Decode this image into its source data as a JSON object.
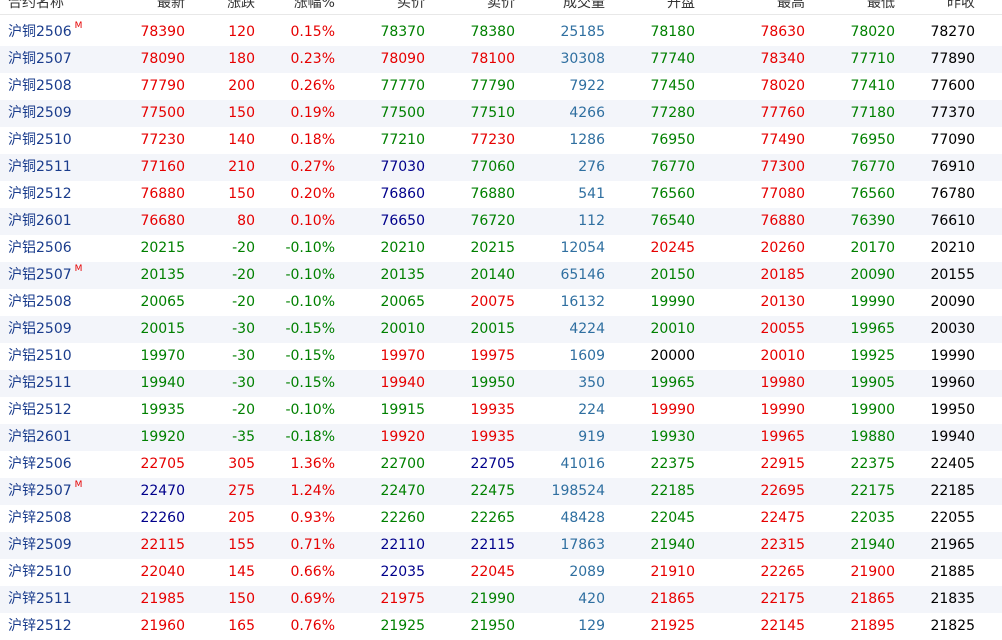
{
  "headers": [
    "合约名称",
    "最新",
    "涨跌",
    "涨幅%",
    "买价",
    "卖价",
    "成交量",
    "开盘",
    "最高",
    "最低",
    "昨收"
  ],
  "colors": {
    "up": "#e60000",
    "down": "#008000",
    "flat": "#000000",
    "navy": "#00008b",
    "volume": "#2f6fa0",
    "name": "#1a3c8c"
  },
  "rows": [
    {
      "name": "沪铜2506",
      "mark": "M",
      "cells": [
        {
          "v": "78390",
          "c": "up"
        },
        {
          "v": "120",
          "c": "up"
        },
        {
          "v": "0.15%",
          "c": "up"
        },
        {
          "v": "78370",
          "c": "dn"
        },
        {
          "v": "78380",
          "c": "dn"
        },
        {
          "v": "25185",
          "c": "vol"
        },
        {
          "v": "78180",
          "c": "dn"
        },
        {
          "v": "78630",
          "c": "up"
        },
        {
          "v": "78020",
          "c": "dn"
        },
        {
          "v": "78270",
          "c": "fl"
        }
      ]
    },
    {
      "name": "沪铜2507",
      "mark": "",
      "cells": [
        {
          "v": "78090",
          "c": "up"
        },
        {
          "v": "180",
          "c": "up"
        },
        {
          "v": "0.23%",
          "c": "up"
        },
        {
          "v": "78090",
          "c": "up"
        },
        {
          "v": "78100",
          "c": "up"
        },
        {
          "v": "30308",
          "c": "vol"
        },
        {
          "v": "77740",
          "c": "dn"
        },
        {
          "v": "78340",
          "c": "up"
        },
        {
          "v": "77710",
          "c": "dn"
        },
        {
          "v": "77890",
          "c": "fl"
        }
      ]
    },
    {
      "name": "沪铜2508",
      "mark": "",
      "cells": [
        {
          "v": "77790",
          "c": "up"
        },
        {
          "v": "200",
          "c": "up"
        },
        {
          "v": "0.26%",
          "c": "up"
        },
        {
          "v": "77770",
          "c": "dn"
        },
        {
          "v": "77790",
          "c": "dn"
        },
        {
          "v": "7922",
          "c": "vol"
        },
        {
          "v": "77450",
          "c": "dn"
        },
        {
          "v": "78020",
          "c": "up"
        },
        {
          "v": "77410",
          "c": "dn"
        },
        {
          "v": "77600",
          "c": "fl"
        }
      ]
    },
    {
      "name": "沪铜2509",
      "mark": "",
      "cells": [
        {
          "v": "77500",
          "c": "up"
        },
        {
          "v": "150",
          "c": "up"
        },
        {
          "v": "0.19%",
          "c": "up"
        },
        {
          "v": "77500",
          "c": "dn"
        },
        {
          "v": "77510",
          "c": "dn"
        },
        {
          "v": "4266",
          "c": "vol"
        },
        {
          "v": "77280",
          "c": "dn"
        },
        {
          "v": "77760",
          "c": "up"
        },
        {
          "v": "77180",
          "c": "dn"
        },
        {
          "v": "77370",
          "c": "fl"
        }
      ]
    },
    {
      "name": "沪铜2510",
      "mark": "",
      "cells": [
        {
          "v": "77230",
          "c": "up"
        },
        {
          "v": "140",
          "c": "up"
        },
        {
          "v": "0.18%",
          "c": "up"
        },
        {
          "v": "77210",
          "c": "dn"
        },
        {
          "v": "77230",
          "c": "up"
        },
        {
          "v": "1286",
          "c": "vol"
        },
        {
          "v": "76950",
          "c": "dn"
        },
        {
          "v": "77490",
          "c": "up"
        },
        {
          "v": "76950",
          "c": "dn"
        },
        {
          "v": "77090",
          "c": "fl"
        }
      ]
    },
    {
      "name": "沪铜2511",
      "mark": "",
      "cells": [
        {
          "v": "77160",
          "c": "up"
        },
        {
          "v": "210",
          "c": "up"
        },
        {
          "v": "0.27%",
          "c": "up"
        },
        {
          "v": "77030",
          "c": "nb"
        },
        {
          "v": "77060",
          "c": "dn"
        },
        {
          "v": "276",
          "c": "vol"
        },
        {
          "v": "76770",
          "c": "dn"
        },
        {
          "v": "77300",
          "c": "up"
        },
        {
          "v": "76770",
          "c": "dn"
        },
        {
          "v": "76910",
          "c": "fl"
        }
      ]
    },
    {
      "name": "沪铜2512",
      "mark": "",
      "cells": [
        {
          "v": "76880",
          "c": "up"
        },
        {
          "v": "150",
          "c": "up"
        },
        {
          "v": "0.20%",
          "c": "up"
        },
        {
          "v": "76860",
          "c": "nb"
        },
        {
          "v": "76880",
          "c": "dn"
        },
        {
          "v": "541",
          "c": "vol"
        },
        {
          "v": "76560",
          "c": "dn"
        },
        {
          "v": "77080",
          "c": "up"
        },
        {
          "v": "76560",
          "c": "dn"
        },
        {
          "v": "76780",
          "c": "fl"
        }
      ]
    },
    {
      "name": "沪铜2601",
      "mark": "",
      "cells": [
        {
          "v": "76680",
          "c": "up"
        },
        {
          "v": "80",
          "c": "up"
        },
        {
          "v": "0.10%",
          "c": "up"
        },
        {
          "v": "76650",
          "c": "nb"
        },
        {
          "v": "76720",
          "c": "dn"
        },
        {
          "v": "112",
          "c": "vol"
        },
        {
          "v": "76540",
          "c": "dn"
        },
        {
          "v": "76880",
          "c": "up"
        },
        {
          "v": "76390",
          "c": "dn"
        },
        {
          "v": "76610",
          "c": "fl"
        }
      ]
    },
    {
      "name": "沪铝2506",
      "mark": "",
      "cells": [
        {
          "v": "20215",
          "c": "dn"
        },
        {
          "v": "-20",
          "c": "dn"
        },
        {
          "v": "-0.10%",
          "c": "dn"
        },
        {
          "v": "20210",
          "c": "dn"
        },
        {
          "v": "20215",
          "c": "dn"
        },
        {
          "v": "12054",
          "c": "vol"
        },
        {
          "v": "20245",
          "c": "up"
        },
        {
          "v": "20260",
          "c": "up"
        },
        {
          "v": "20170",
          "c": "dn"
        },
        {
          "v": "20210",
          "c": "fl"
        }
      ]
    },
    {
      "name": "沪铝2507",
      "mark": "M",
      "cells": [
        {
          "v": "20135",
          "c": "dn"
        },
        {
          "v": "-20",
          "c": "dn"
        },
        {
          "v": "-0.10%",
          "c": "dn"
        },
        {
          "v": "20135",
          "c": "dn"
        },
        {
          "v": "20140",
          "c": "dn"
        },
        {
          "v": "65146",
          "c": "vol"
        },
        {
          "v": "20150",
          "c": "dn"
        },
        {
          "v": "20185",
          "c": "up"
        },
        {
          "v": "20090",
          "c": "dn"
        },
        {
          "v": "20155",
          "c": "fl"
        }
      ]
    },
    {
      "name": "沪铝2508",
      "mark": "",
      "cells": [
        {
          "v": "20065",
          "c": "dn"
        },
        {
          "v": "-20",
          "c": "dn"
        },
        {
          "v": "-0.10%",
          "c": "dn"
        },
        {
          "v": "20065",
          "c": "dn"
        },
        {
          "v": "20075",
          "c": "up"
        },
        {
          "v": "16132",
          "c": "vol"
        },
        {
          "v": "19990",
          "c": "dn"
        },
        {
          "v": "20130",
          "c": "up"
        },
        {
          "v": "19990",
          "c": "dn"
        },
        {
          "v": "20090",
          "c": "fl"
        }
      ]
    },
    {
      "name": "沪铝2509",
      "mark": "",
      "cells": [
        {
          "v": "20015",
          "c": "dn"
        },
        {
          "v": "-30",
          "c": "dn"
        },
        {
          "v": "-0.15%",
          "c": "dn"
        },
        {
          "v": "20010",
          "c": "dn"
        },
        {
          "v": "20015",
          "c": "dn"
        },
        {
          "v": "4224",
          "c": "vol"
        },
        {
          "v": "20010",
          "c": "dn"
        },
        {
          "v": "20055",
          "c": "up"
        },
        {
          "v": "19965",
          "c": "dn"
        },
        {
          "v": "20030",
          "c": "fl"
        }
      ]
    },
    {
      "name": "沪铝2510",
      "mark": "",
      "cells": [
        {
          "v": "19970",
          "c": "dn"
        },
        {
          "v": "-30",
          "c": "dn"
        },
        {
          "v": "-0.15%",
          "c": "dn"
        },
        {
          "v": "19970",
          "c": "up"
        },
        {
          "v": "19975",
          "c": "up"
        },
        {
          "v": "1609",
          "c": "vol"
        },
        {
          "v": "20000",
          "c": "fl"
        },
        {
          "v": "20010",
          "c": "up"
        },
        {
          "v": "19925",
          "c": "dn"
        },
        {
          "v": "19990",
          "c": "fl"
        }
      ]
    },
    {
      "name": "沪铝2511",
      "mark": "",
      "cells": [
        {
          "v": "19940",
          "c": "dn"
        },
        {
          "v": "-30",
          "c": "dn"
        },
        {
          "v": "-0.15%",
          "c": "dn"
        },
        {
          "v": "19940",
          "c": "up"
        },
        {
          "v": "19950",
          "c": "dn"
        },
        {
          "v": "350",
          "c": "vol"
        },
        {
          "v": "19965",
          "c": "dn"
        },
        {
          "v": "19980",
          "c": "up"
        },
        {
          "v": "19905",
          "c": "dn"
        },
        {
          "v": "19960",
          "c": "fl"
        }
      ]
    },
    {
      "name": "沪铝2512",
      "mark": "",
      "cells": [
        {
          "v": "19935",
          "c": "dn"
        },
        {
          "v": "-20",
          "c": "dn"
        },
        {
          "v": "-0.10%",
          "c": "dn"
        },
        {
          "v": "19915",
          "c": "dn"
        },
        {
          "v": "19935",
          "c": "up"
        },
        {
          "v": "224",
          "c": "vol"
        },
        {
          "v": "19990",
          "c": "up"
        },
        {
          "v": "19990",
          "c": "up"
        },
        {
          "v": "19900",
          "c": "dn"
        },
        {
          "v": "19950",
          "c": "fl"
        }
      ]
    },
    {
      "name": "沪铝2601",
      "mark": "",
      "cells": [
        {
          "v": "19920",
          "c": "dn"
        },
        {
          "v": "-35",
          "c": "dn"
        },
        {
          "v": "-0.18%",
          "c": "dn"
        },
        {
          "v": "19920",
          "c": "up"
        },
        {
          "v": "19935",
          "c": "up"
        },
        {
          "v": "919",
          "c": "vol"
        },
        {
          "v": "19930",
          "c": "dn"
        },
        {
          "v": "19965",
          "c": "up"
        },
        {
          "v": "19880",
          "c": "dn"
        },
        {
          "v": "19940",
          "c": "fl"
        }
      ]
    },
    {
      "name": "沪锌2506",
      "mark": "",
      "cells": [
        {
          "v": "22705",
          "c": "up"
        },
        {
          "v": "305",
          "c": "up"
        },
        {
          "v": "1.36%",
          "c": "up"
        },
        {
          "v": "22700",
          "c": "dn"
        },
        {
          "v": "22705",
          "c": "nb"
        },
        {
          "v": "41016",
          "c": "vol"
        },
        {
          "v": "22375",
          "c": "dn"
        },
        {
          "v": "22915",
          "c": "up"
        },
        {
          "v": "22375",
          "c": "dn"
        },
        {
          "v": "22405",
          "c": "fl"
        }
      ]
    },
    {
      "name": "沪锌2507",
      "mark": "M",
      "cells": [
        {
          "v": "22470",
          "c": "nb"
        },
        {
          "v": "275",
          "c": "up"
        },
        {
          "v": "1.24%",
          "c": "up"
        },
        {
          "v": "22470",
          "c": "dn"
        },
        {
          "v": "22475",
          "c": "dn"
        },
        {
          "v": "198524",
          "c": "vol"
        },
        {
          "v": "22185",
          "c": "dn"
        },
        {
          "v": "22695",
          "c": "up"
        },
        {
          "v": "22175",
          "c": "dn"
        },
        {
          "v": "22185",
          "c": "fl"
        }
      ]
    },
    {
      "name": "沪锌2508",
      "mark": "",
      "cells": [
        {
          "v": "22260",
          "c": "nb"
        },
        {
          "v": "205",
          "c": "up"
        },
        {
          "v": "0.93%",
          "c": "up"
        },
        {
          "v": "22260",
          "c": "dn"
        },
        {
          "v": "22265",
          "c": "dn"
        },
        {
          "v": "48428",
          "c": "vol"
        },
        {
          "v": "22045",
          "c": "dn"
        },
        {
          "v": "22475",
          "c": "up"
        },
        {
          "v": "22035",
          "c": "dn"
        },
        {
          "v": "22055",
          "c": "fl"
        }
      ]
    },
    {
      "name": "沪锌2509",
      "mark": "",
      "cells": [
        {
          "v": "22115",
          "c": "up"
        },
        {
          "v": "155",
          "c": "up"
        },
        {
          "v": "0.71%",
          "c": "up"
        },
        {
          "v": "22110",
          "c": "nb"
        },
        {
          "v": "22115",
          "c": "nb"
        },
        {
          "v": "17863",
          "c": "vol"
        },
        {
          "v": "21940",
          "c": "dn"
        },
        {
          "v": "22315",
          "c": "up"
        },
        {
          "v": "21940",
          "c": "dn"
        },
        {
          "v": "21965",
          "c": "fl"
        }
      ]
    },
    {
      "name": "沪锌2510",
      "mark": "",
      "cells": [
        {
          "v": "22040",
          "c": "up"
        },
        {
          "v": "145",
          "c": "up"
        },
        {
          "v": "0.66%",
          "c": "up"
        },
        {
          "v": "22035",
          "c": "nb"
        },
        {
          "v": "22045",
          "c": "up"
        },
        {
          "v": "2089",
          "c": "vol"
        },
        {
          "v": "21910",
          "c": "up"
        },
        {
          "v": "22265",
          "c": "up"
        },
        {
          "v": "21900",
          "c": "up"
        },
        {
          "v": "21885",
          "c": "fl"
        }
      ]
    },
    {
      "name": "沪锌2511",
      "mark": "",
      "cells": [
        {
          "v": "21985",
          "c": "up"
        },
        {
          "v": "150",
          "c": "up"
        },
        {
          "v": "0.69%",
          "c": "up"
        },
        {
          "v": "21975",
          "c": "up"
        },
        {
          "v": "21990",
          "c": "dn"
        },
        {
          "v": "420",
          "c": "vol"
        },
        {
          "v": "21865",
          "c": "up"
        },
        {
          "v": "22175",
          "c": "up"
        },
        {
          "v": "21865",
          "c": "up"
        },
        {
          "v": "21835",
          "c": "fl"
        }
      ]
    },
    {
      "name": "沪锌2512",
      "mark": "",
      "cells": [
        {
          "v": "21960",
          "c": "up"
        },
        {
          "v": "165",
          "c": "up"
        },
        {
          "v": "0.76%",
          "c": "up"
        },
        {
          "v": "21925",
          "c": "dn"
        },
        {
          "v": "21950",
          "c": "dn"
        },
        {
          "v": "129",
          "c": "vol"
        },
        {
          "v": "21925",
          "c": "up"
        },
        {
          "v": "22145",
          "c": "up"
        },
        {
          "v": "21895",
          "c": "up"
        },
        {
          "v": "21825",
          "c": "fl"
        }
      ]
    }
  ]
}
